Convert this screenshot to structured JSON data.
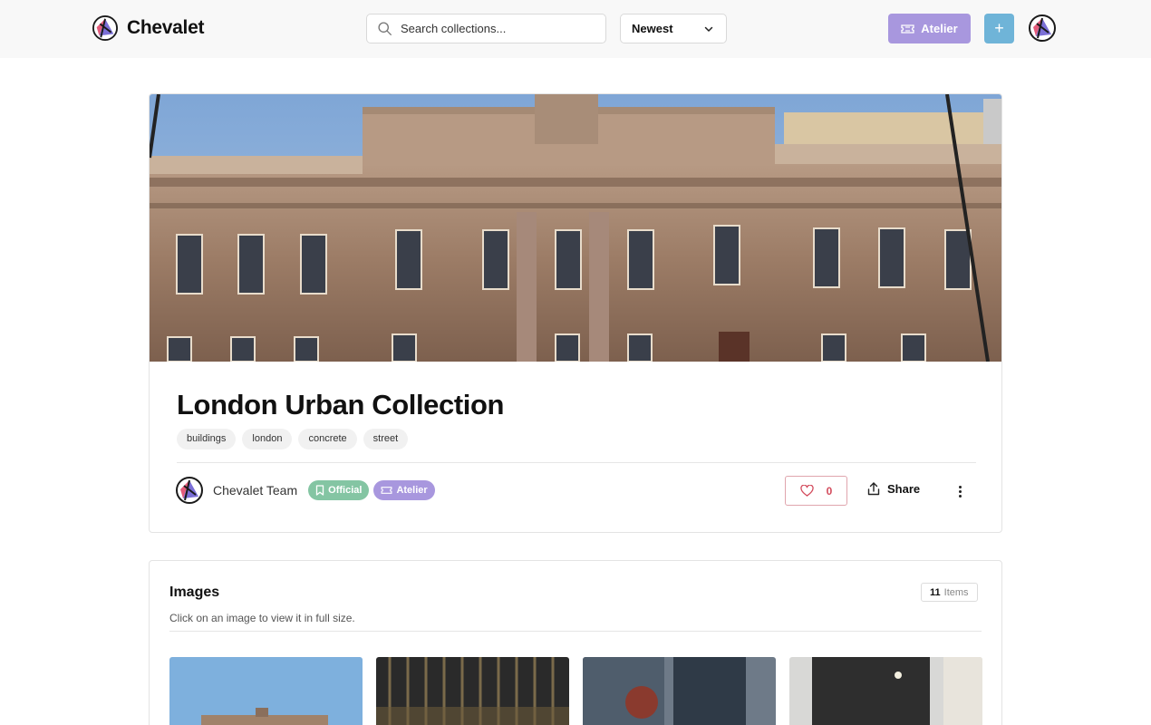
{
  "header": {
    "brand": "Chevalet",
    "search_placeholder": "Search collections...",
    "sort_selected": "Newest",
    "atelier_label": "Atelier",
    "add_label": "+"
  },
  "collection": {
    "title": "London Urban Collection",
    "tags": [
      "buildings",
      "london",
      "concrete",
      "street"
    ],
    "author": "Chevalet Team",
    "badges": {
      "official": "Official",
      "atelier": "Atelier"
    },
    "likes": "0",
    "share_label": "Share"
  },
  "images_section": {
    "title": "Images",
    "subtitle": "Click on an image to view it in full size.",
    "count": "11",
    "count_label": "Items"
  },
  "colors": {
    "atelier": "#a897de",
    "official": "#84c5a3",
    "plus": "#6fb4d8",
    "like": "#d34b5c"
  },
  "icons": [
    "search-icon",
    "chevron-down-icon",
    "ticket-icon",
    "plus-icon",
    "bookmark-icon",
    "heart-icon",
    "share-icon",
    "more-vertical-icon"
  ]
}
